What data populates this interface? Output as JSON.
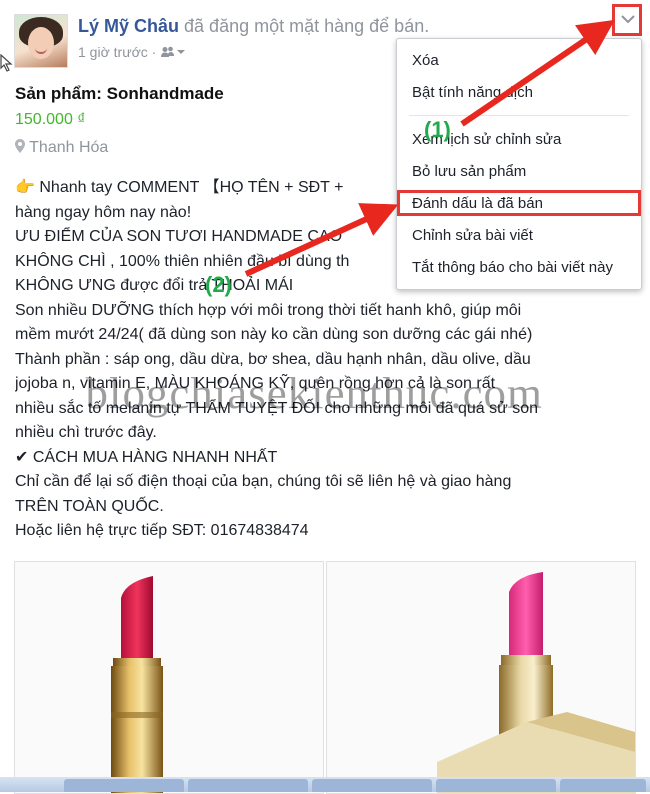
{
  "post": {
    "author": "Lý Mỹ Châu",
    "action": "đã đăng một mặt hàng để bán.",
    "time": "1 giờ trước ·"
  },
  "product": {
    "title": "Sản phẩm: Sonhandmade",
    "price": "150.000 ₫",
    "location": "Thanh Hóa"
  },
  "description": [
    "👉 Nhanh tay COMMENT 【HỌ TÊN + SĐT +",
    "hàng ngay hôm nay nào!",
    "ƯU ĐIỂM CỦA SON TƯƠI HANDMADE CAO",
    "KHÔNG CHÌ , 100% thiên nhiên đầu bí dùng th",
    "KHÔNG ƯNG được đổi trả THOẢI MÁI",
    "Son nhiều DƯỠNG thích hợp với môi trong thời tiết hanh khô, giúp môi",
    "mềm mướt 24/24( đã dùng son này ko cần dùng son dưỡng các gái nhé)",
    "Thành phần : sáp ong, dầu dừa, bơ shea, dầu hạnh nhân, dầu olive, dầu",
    "jojoba n, vitamin E, MÀU KHOÁNG KỸ, quên rồng hơn cả là son rất",
    "nhiều sắc tố melanin tự THẨM TUYỆT ĐỐI cho những môi đã quá sử son",
    "nhiều chì trước đây.",
    "✔ CÁCH MUA HÀNG NHANH NHẤT",
    "Chỉ cần để lại số điện thoại của bạn, chúng tôi sẽ liên hệ và giao hàng",
    "TRÊN TOÀN QUỐC.",
    "Hoặc liên hệ trực tiếp SĐT: 01674838474"
  ],
  "menu": {
    "items": [
      "Xóa",
      "Bật tính năng dịch",
      "Xem lịch sử chỉnh sửa",
      "Bỏ lưu sản phẩm",
      "Đánh dấu là đã bán",
      "Chỉnh sửa bài viết",
      "Tắt thông báo cho bài viết này"
    ]
  },
  "annotations": {
    "step1": "(1)",
    "step2": "(2)"
  },
  "watermark": "blogchiasekienthuc.com",
  "icons": {
    "dropdown": "chevron-down-icon",
    "location": "map-pin-icon",
    "audience": "friends-icon",
    "cursor": "mouse-pointer-icon"
  },
  "colors": {
    "link": "#365899",
    "price": "#42b72a",
    "highlight": "#e53935",
    "annotation": "#22a94b"
  }
}
